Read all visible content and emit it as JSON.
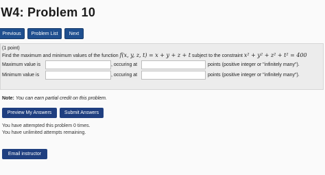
{
  "header": {
    "title": "IW4: Problem 10"
  },
  "nav": {
    "previous": "Previous",
    "problem_list": "Problem List",
    "next": "Next"
  },
  "problem": {
    "points": "(1 point)",
    "statement_prefix": "Find the maximum and minimum values of the function",
    "function_expr": "f(x, y, z, t) = x + y + z + t",
    "statement_mid": "subject to the constraint",
    "constraint_expr": "x² + y² + z² + t² = 400",
    "max_label": "Maximum value is",
    "max_value": "",
    "max_occurring_label": ", occuring at",
    "max_occurring_value": "",
    "max_hint": "points (positive integer or \"infinitely many\").",
    "min_label": "Minimum value is",
    "min_value": "",
    "min_occurring_label": ", occuring at",
    "min_occurring_value": "",
    "min_hint": "points (positive integer or \"infinitely many\")."
  },
  "note": {
    "label": "Note:",
    "text": "You can earn partial credit on this problem."
  },
  "actions": {
    "preview": "Preview My Answers",
    "submit": "Submit Answers"
  },
  "status": {
    "attempted": "You have attempted this problem 0 times.",
    "remaining": "You have unlimited attempts remaining."
  },
  "footer": {
    "email_instructor": "Email instructor"
  },
  "colors": {
    "button_bg": "#1f4f8f",
    "panel_bg": "#ececec"
  }
}
